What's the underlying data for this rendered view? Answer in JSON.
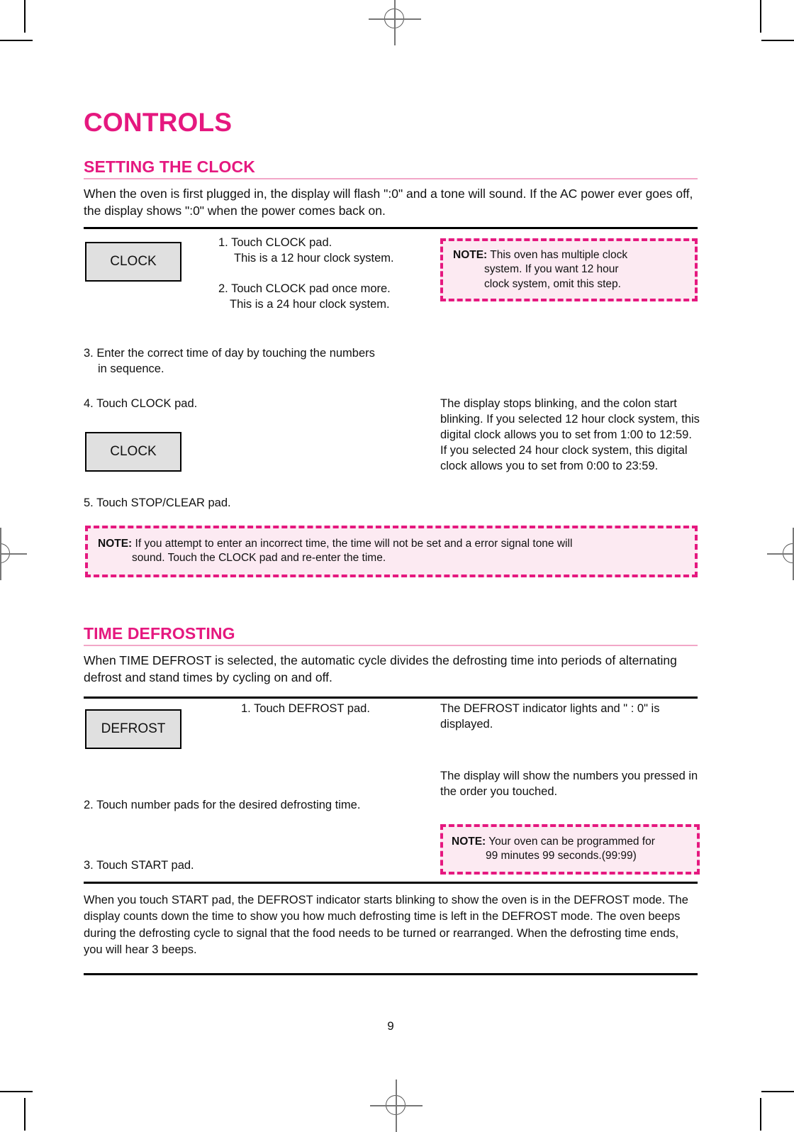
{
  "document": {
    "main_title": "CONTROLS",
    "page_number": "9"
  },
  "sections": [
    {
      "heading": "SETTING THE CLOCK",
      "intro": "When the oven is first plugged in, the display will flash \":0\" and a tone will sound. If the AC power ever goes off, the display shows \":0\" when the power  comes back on.",
      "pads": [
        {
          "label": "CLOCK"
        },
        {
          "label": "CLOCK"
        }
      ],
      "steps": [
        {
          "number": "1.",
          "text": "Touch CLOCK pad.",
          "sub": "This is a 12 hour clock system."
        },
        {
          "number": "2.",
          "text": "Touch CLOCK pad once more.",
          "sub": "This is a 24 hour clock system."
        },
        {
          "number": "3.",
          "text": "Enter the correct time of day by touching the numbers",
          "sub": "in sequence."
        },
        {
          "number": "4.",
          "text": "Touch CLOCK pad.",
          "sub": ""
        },
        {
          "number": "5.",
          "text": "Touch STOP/CLEAR pad.",
          "sub": ""
        }
      ],
      "results": [
        "The display stops blinking, and the colon start blinking. If you selected 12 hour clock system, this digital clock allows you to set from 1:00 to 12:59. If you selected 24 hour clock system, this digital clock allows you to set from 0:00 to 23:59."
      ],
      "notes": [
        {
          "label": "NOTE:",
          "line1": "This oven has multiple clock",
          "line2": "system. If you want 12 hour",
          "line3": "clock system, omit this step."
        },
        {
          "label": "NOTE:",
          "line1": "If you attempt to enter an incorrect time, the time will not be set and a error signal tone will",
          "line2": "sound. Touch the CLOCK pad and re-enter the time.",
          "line3": ""
        }
      ]
    },
    {
      "heading": "TIME DEFROSTING",
      "intro": "When TIME DEFROST is selected, the automatic cycle divides the defrosting time into periods of alternating defrost and stand times by cycling on and off.",
      "pads": [
        {
          "label": "DEFROST"
        }
      ],
      "steps": [
        {
          "number": "1.",
          "text": "Touch DEFROST pad.",
          "sub": ""
        },
        {
          "number": "2.",
          "text": "Touch number pads for the desired defrosting time.",
          "sub": ""
        },
        {
          "number": "3.",
          "text": "Touch START pad.",
          "sub": ""
        }
      ],
      "results": [
        "The DEFROST indicator lights and \" : 0\" is displayed.",
        "The display will show the numbers you pressed in the order you touched."
      ],
      "notes": [
        {
          "label": "NOTE:",
          "line1": "Your oven can be programmed for",
          "line2": "99 minutes 99 seconds.(99:99)",
          "line3": ""
        }
      ],
      "closing": "When you touch START pad, the DEFROST indicator starts blinking to show the oven is in the DEFROST mode. The display counts down the time to show you how much defrosting time is left in the DEFROST mode. The oven beeps during the defrosting cycle to signal that the food needs to be turned or rearranged. When the defrosting time ends, you will hear 3 beeps."
    }
  ],
  "colors": {
    "accent_pink": "#e5187f",
    "rule_pink": "#f2a7c8",
    "note_bg": "#fceaf2",
    "pad_bg": "#e0e0e0"
  }
}
